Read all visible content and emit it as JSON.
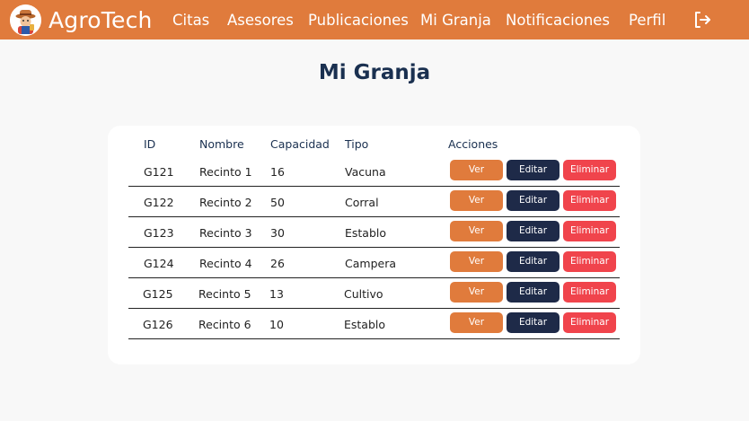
{
  "navbar": {
    "brand": "AgroTech",
    "links": [
      "Citas",
      "Asesores",
      "Publicaciones",
      "Mi Granja",
      "Notificaciones",
      "Perfil"
    ],
    "logout_icon": "logout-icon",
    "color": "#e07b3c"
  },
  "page": {
    "title": "Mi Granja"
  },
  "table": {
    "headers": [
      "ID",
      "Nombre",
      "Capacidad",
      "Tipo",
      "Acciones"
    ],
    "rows": [
      {
        "id": "G121",
        "nombre": "Recinto 1",
        "capacidad": "16",
        "tipo": "Vacuna"
      },
      {
        "id": "G122",
        "nombre": "Recinto 2",
        "capacidad": "50",
        "tipo": "Corral"
      },
      {
        "id": "G123",
        "nombre": "Recinto 3",
        "capacidad": "30",
        "tipo": "Establo"
      },
      {
        "id": "G124",
        "nombre": "Recinto 4",
        "capacidad": "26",
        "tipo": "Campera"
      },
      {
        "id": "G125",
        "nombre": "Recinto 5",
        "capacidad": "13",
        "tipo": "Cultivo"
      },
      {
        "id": "G126",
        "nombre": "Recinto 6",
        "capacidad": "10",
        "tipo": "Establo"
      }
    ],
    "actions": {
      "view": "Ver",
      "edit": "Editar",
      "delete": "Eliminar"
    },
    "colors": {
      "view": "#e07b3c",
      "edit": "#1e2a48",
      "delete": "#f0444c"
    }
  }
}
